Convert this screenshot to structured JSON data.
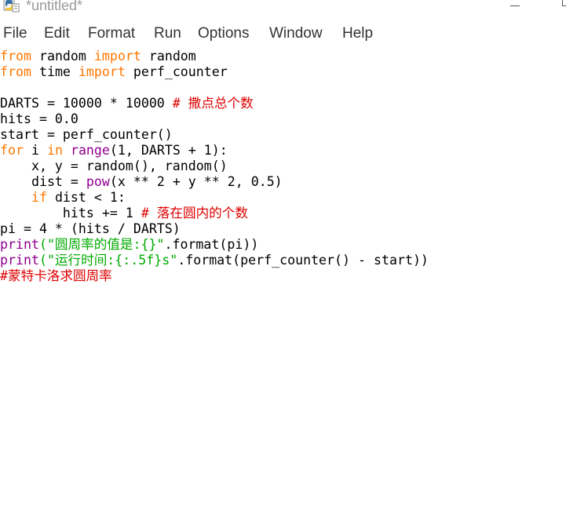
{
  "window": {
    "title": "*untitled*",
    "icon": "python-icon"
  },
  "menu": {
    "items": [
      "File",
      "Edit",
      "Format",
      "Run",
      "Options",
      "Window",
      "Help"
    ]
  },
  "colors": {
    "keyword": "#ff7700",
    "builtin": "#900090",
    "string": "#00aa00",
    "comment": "#dd0000",
    "text": "#000000"
  },
  "code": {
    "lines": [
      [
        {
          "t": "from",
          "c": "kw"
        },
        {
          "t": " random "
        },
        {
          "t": "import",
          "c": "kw"
        },
        {
          "t": " random"
        }
      ],
      [
        {
          "t": "from",
          "c": "kw"
        },
        {
          "t": " time "
        },
        {
          "t": "import",
          "c": "kw"
        },
        {
          "t": " perf_counter"
        }
      ],
      [],
      [
        {
          "t": "DARTS = 10000 * 10000 "
        },
        {
          "t": "# 撒点总个数",
          "c": "cm"
        }
      ],
      [
        {
          "t": "hits = 0.0"
        }
      ],
      [
        {
          "t": "start = perf_counter()"
        }
      ],
      [
        {
          "t": "for",
          "c": "kw"
        },
        {
          "t": " i "
        },
        {
          "t": "in",
          "c": "kw"
        },
        {
          "t": " "
        },
        {
          "t": "range",
          "c": "bi"
        },
        {
          "t": "(1, DARTS + 1):"
        }
      ],
      [
        {
          "t": "    x, y = random(), random()"
        }
      ],
      [
        {
          "t": "    dist = "
        },
        {
          "t": "pow",
          "c": "bi"
        },
        {
          "t": "(x ** 2 + y ** 2, 0.5)"
        }
      ],
      [
        {
          "t": "    "
        },
        {
          "t": "if",
          "c": "kw"
        },
        {
          "t": " dist < 1:"
        }
      ],
      [
        {
          "t": "        hits += 1 "
        },
        {
          "t": "# 落在圆内的个数",
          "c": "cm"
        }
      ],
      [
        {
          "t": "pi = 4 * (hits / DARTS)"
        }
      ],
      [
        {
          "t": "print",
          "c": "bi"
        },
        {
          "t": "(\"圆周率的值是:{}\"",
          "c": "str"
        },
        {
          "t": ".format(pi))"
        }
      ],
      [
        {
          "t": "print",
          "c": "bi"
        },
        {
          "t": "(\"运行时间:{:.5f}s\"",
          "c": "str"
        },
        {
          "t": ".format(perf_counter() - start))"
        }
      ],
      [
        {
          "t": "#蒙特卡洛求圆周率",
          "c": "cm"
        }
      ]
    ]
  }
}
